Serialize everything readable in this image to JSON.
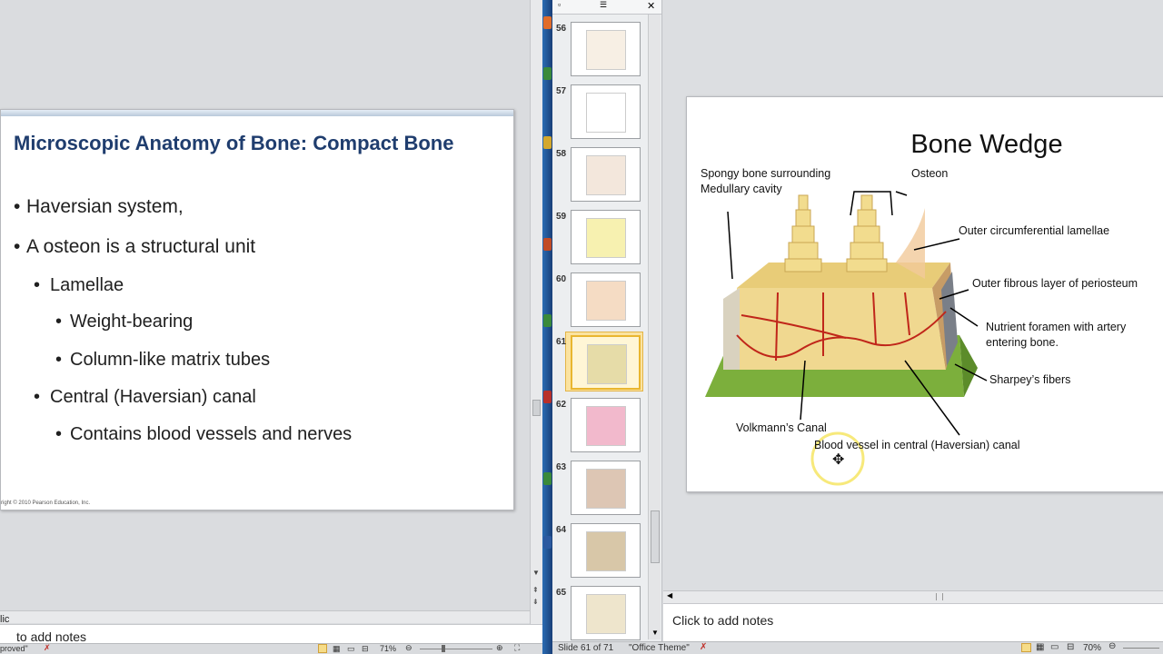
{
  "left_window": {
    "slide": {
      "title": "Microscopic Anatomy of Bone: Compact Bone",
      "bullets": [
        {
          "level": 1,
          "text": "Haversian  system,"
        },
        {
          "level": 1,
          "text": "A osteon is a structural unit"
        },
        {
          "level": 2,
          "text": "Lamellae"
        },
        {
          "level": 3,
          "text": "Weight-bearing"
        },
        {
          "level": 3,
          "text": "Column-like matrix tubes"
        },
        {
          "level": 2,
          "text": "Central (Haversian) canal"
        },
        {
          "level": 3,
          "text": "Contains blood vessels and nerves"
        }
      ],
      "copyright": "right © 2010 Pearson Education, Inc."
    },
    "notes_placeholder": "to add notes",
    "notes_prefix": "lic",
    "status_left": "proved\"",
    "zoom": "71%"
  },
  "right_window": {
    "thumbnails": [
      {
        "number": "56"
      },
      {
        "number": "57"
      },
      {
        "number": "58"
      },
      {
        "number": "59"
      },
      {
        "number": "60"
      },
      {
        "number": "61",
        "selected": true
      },
      {
        "number": "62"
      },
      {
        "number": "63"
      },
      {
        "number": "64"
      },
      {
        "number": "65"
      }
    ],
    "slide": {
      "title": "Bone Wedge",
      "labels": {
        "spongy": "Spongy bone surrounding",
        "spongy2": "Medullary cavity",
        "osteon": "Osteon",
        "outer_circ": "Outer circumferential lamellae",
        "outer_fibrous": "Outer fibrous layer of periosteum",
        "nutrient": "Nutrient foramen with artery",
        "nutrient2": "entering bone.",
        "sharpey": "Sharpey’s fibers",
        "volkmann": "Volkmann’s Canal",
        "blood_vessel": "Blood vessel in central (Haversian) canal"
      }
    },
    "notes_placeholder": "Click to add notes",
    "status": {
      "slide_of": "Slide 61 of 71",
      "theme": "\"Office Theme\"",
      "zoom": "70%"
    }
  },
  "colors": {
    "title_blue": "#1f3d6e",
    "selection": "#e9b630",
    "bone": "#f0d890",
    "vessel": "#c0261a",
    "base": "#7caf3c"
  }
}
